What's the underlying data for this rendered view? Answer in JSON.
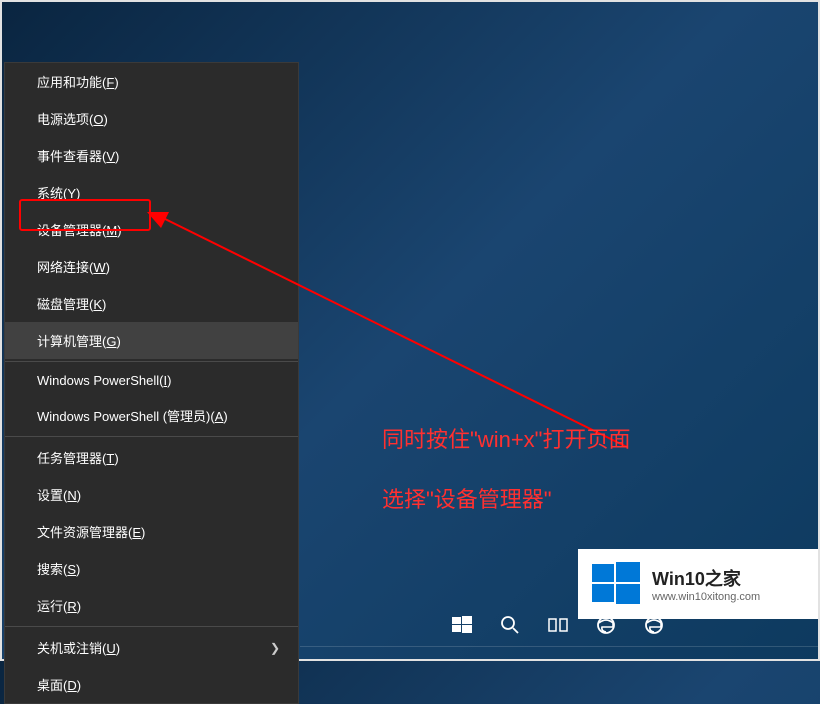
{
  "menu": {
    "items": [
      {
        "label": "应用和功能",
        "key": "F"
      },
      {
        "label": "电源选项",
        "key": "O"
      },
      {
        "label": "事件查看器",
        "key": "V"
      },
      {
        "label": "系统",
        "key": "Y"
      },
      {
        "label": "设备管理器",
        "key": "M"
      },
      {
        "label": "网络连接",
        "key": "W"
      },
      {
        "label": "磁盘管理",
        "key": "K"
      },
      {
        "label": "计算机管理",
        "key": "G"
      },
      {
        "label": "Windows PowerShell",
        "key": "I"
      },
      {
        "label": "Windows PowerShell (管理员)",
        "key": "A"
      },
      {
        "label": "任务管理器",
        "key": "T"
      },
      {
        "label": "设置",
        "key": "N"
      },
      {
        "label": "文件资源管理器",
        "key": "E"
      },
      {
        "label": "搜索",
        "key": "S"
      },
      {
        "label": "运行",
        "key": "R"
      },
      {
        "label": "关机或注销",
        "key": "U"
      },
      {
        "label": "桌面",
        "key": "D"
      }
    ],
    "hovered_index": 7,
    "submenu_index": 15
  },
  "annotation": {
    "line1": "同时按住\"win+x\"打开页面",
    "line2": "选择\"设备管理器\""
  },
  "logo": {
    "title": "Win10之家",
    "url": "www.win10xitong.com"
  },
  "colors": {
    "highlight": "#ff0000",
    "arrow": "#ff0000",
    "annotation_text": "#ff3030",
    "menu_bg": "#2b2b2b",
    "win_blue": "#0078d7"
  },
  "taskbar": {
    "icons": [
      "start",
      "search",
      "task-view",
      "edge",
      "edge-alt"
    ]
  }
}
